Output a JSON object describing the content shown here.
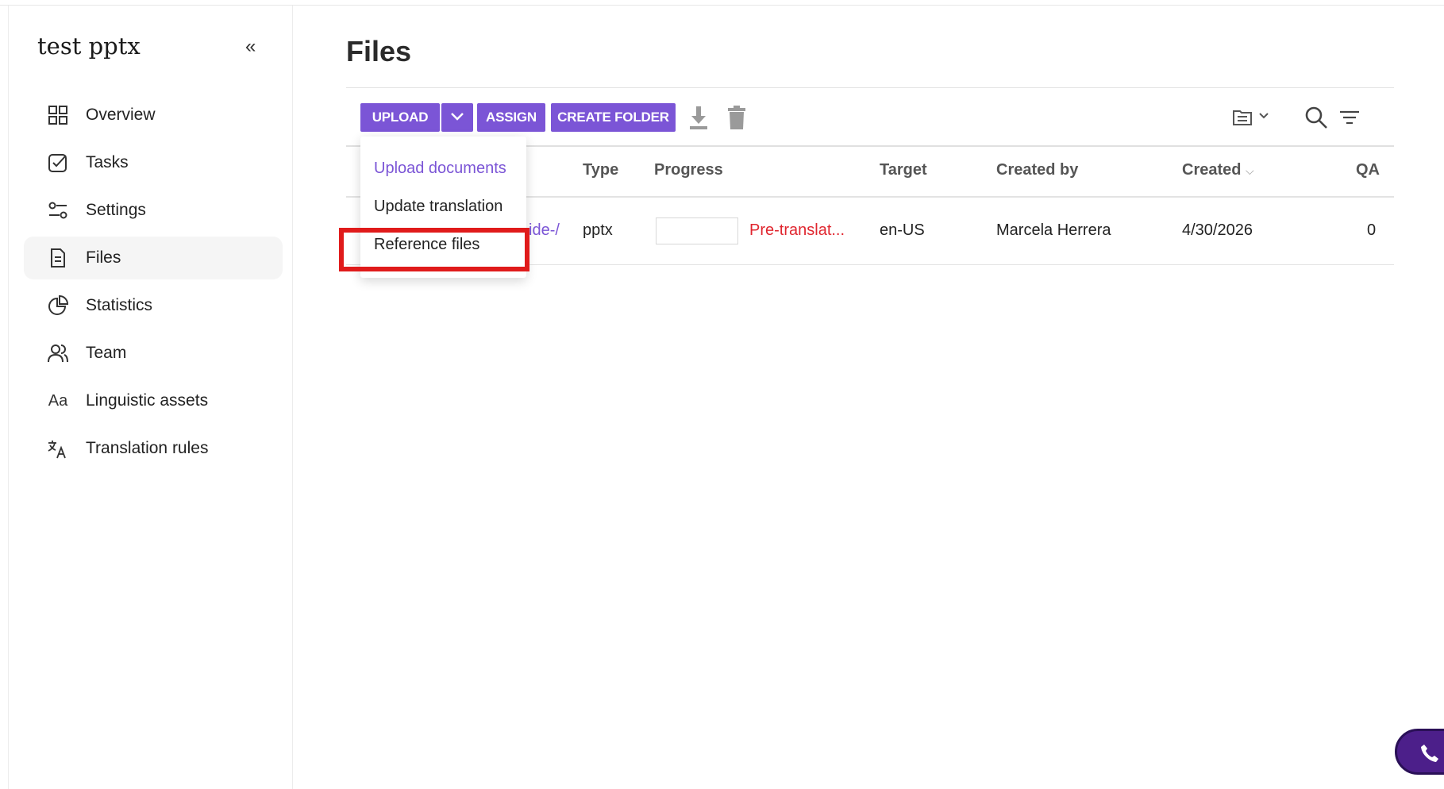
{
  "sidebar": {
    "project_title": "test pptx",
    "collapse_icon": "«",
    "items": [
      {
        "label": "Overview",
        "icon": "grid-icon"
      },
      {
        "label": "Tasks",
        "icon": "checkbox-icon"
      },
      {
        "label": "Settings",
        "icon": "sliders-icon"
      },
      {
        "label": "Files",
        "icon": "file-icon",
        "active": true
      },
      {
        "label": "Statistics",
        "icon": "pie-chart-icon"
      },
      {
        "label": "Team",
        "icon": "team-icon"
      },
      {
        "label": "Linguistic assets",
        "icon": "aa-icon",
        "glyph": "Aa"
      },
      {
        "label": "Translation rules",
        "icon": "translate-icon"
      }
    ]
  },
  "main": {
    "title": "Files",
    "toolbar": {
      "upload_label": "UPLOAD",
      "assign_label": "ASSIGN",
      "create_folder_label": "CREATE FOLDER"
    },
    "upload_menu": {
      "items": [
        "Upload documents",
        "Update translation",
        "Reference files"
      ]
    },
    "table": {
      "columns": [
        "Type",
        "Progress",
        "Target",
        "Created by",
        "Created",
        "QA"
      ],
      "sort_indicator": "⌵",
      "rows": [
        {
          "name_fragment": "ide-/",
          "type": "pptx",
          "progress_status": "Pre-translat...",
          "target": "en-US",
          "created_by": "Marcela Herrera",
          "created": "4/30/2026",
          "qa": "0"
        }
      ]
    }
  },
  "colors": {
    "accent": "#7b55d6",
    "status_red": "#e0262f",
    "highlight": "#e01b1b",
    "call_widget": "#4c1f8a"
  }
}
